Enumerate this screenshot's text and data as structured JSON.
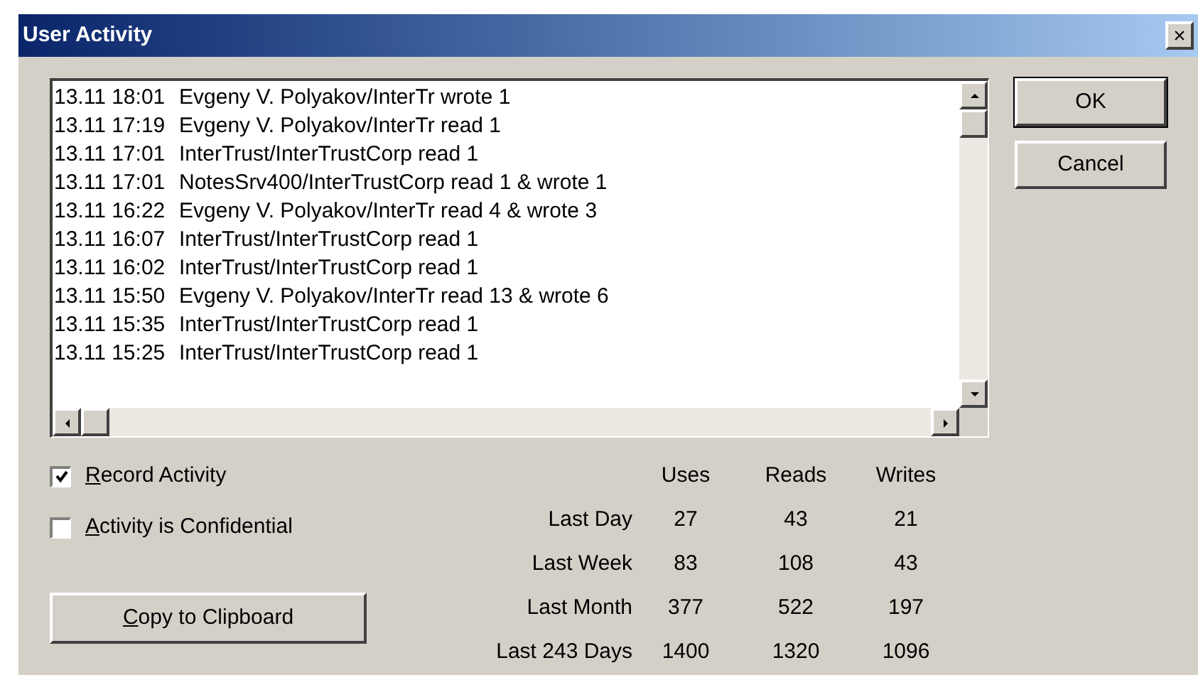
{
  "window": {
    "title": "User Activity",
    "close": "×"
  },
  "log": [
    {
      "time": "13.11 18:01",
      "text": "Evgeny V. Polyakov/InterTr wrote 1"
    },
    {
      "time": "13.11 17:19",
      "text": "Evgeny V. Polyakov/InterTr read 1"
    },
    {
      "time": "13.11 17:01",
      "text": "InterTrust/InterTrustCorp read 1"
    },
    {
      "time": "13.11 17:01",
      "text": "NotesSrv400/InterTrustCorp read 1 & wrote 1"
    },
    {
      "time": "13.11 16:22",
      "text": "Evgeny V. Polyakov/InterTr read 4 & wrote 3"
    },
    {
      "time": "13.11 16:07",
      "text": "InterTrust/InterTrustCorp read 1"
    },
    {
      "time": "13.11 16:02",
      "text": "InterTrust/InterTrustCorp read 1"
    },
    {
      "time": "13.11 15:50",
      "text": "Evgeny V. Polyakov/InterTr read 13 & wrote 6"
    },
    {
      "time": "13.11 15:35",
      "text": "InterTrust/InterTrustCorp read 1"
    },
    {
      "time": "13.11 15:25",
      "text": "InterTrust/InterTrustCorp read 1"
    }
  ],
  "buttons": [
    "OK",
    "Cancel"
  ],
  "options": [
    {
      "label": "Record Activity",
      "checked": true
    },
    {
      "label": "Activity is Confidential",
      "checked": false
    }
  ],
  "copy_button": "Copy to Clipboard",
  "stats": {
    "columns": [
      "Uses",
      "Reads",
      "Writes"
    ],
    "rows": [
      {
        "label": "Last Day",
        "values": [
          "27",
          "43",
          "21"
        ]
      },
      {
        "label": "Last Week",
        "values": [
          "83",
          "108",
          "43"
        ]
      },
      {
        "label": "Last Month",
        "values": [
          "377",
          "522",
          "197"
        ]
      },
      {
        "label": "Last 243 Days",
        "values": [
          "1400",
          "1320",
          "1096"
        ]
      }
    ]
  }
}
